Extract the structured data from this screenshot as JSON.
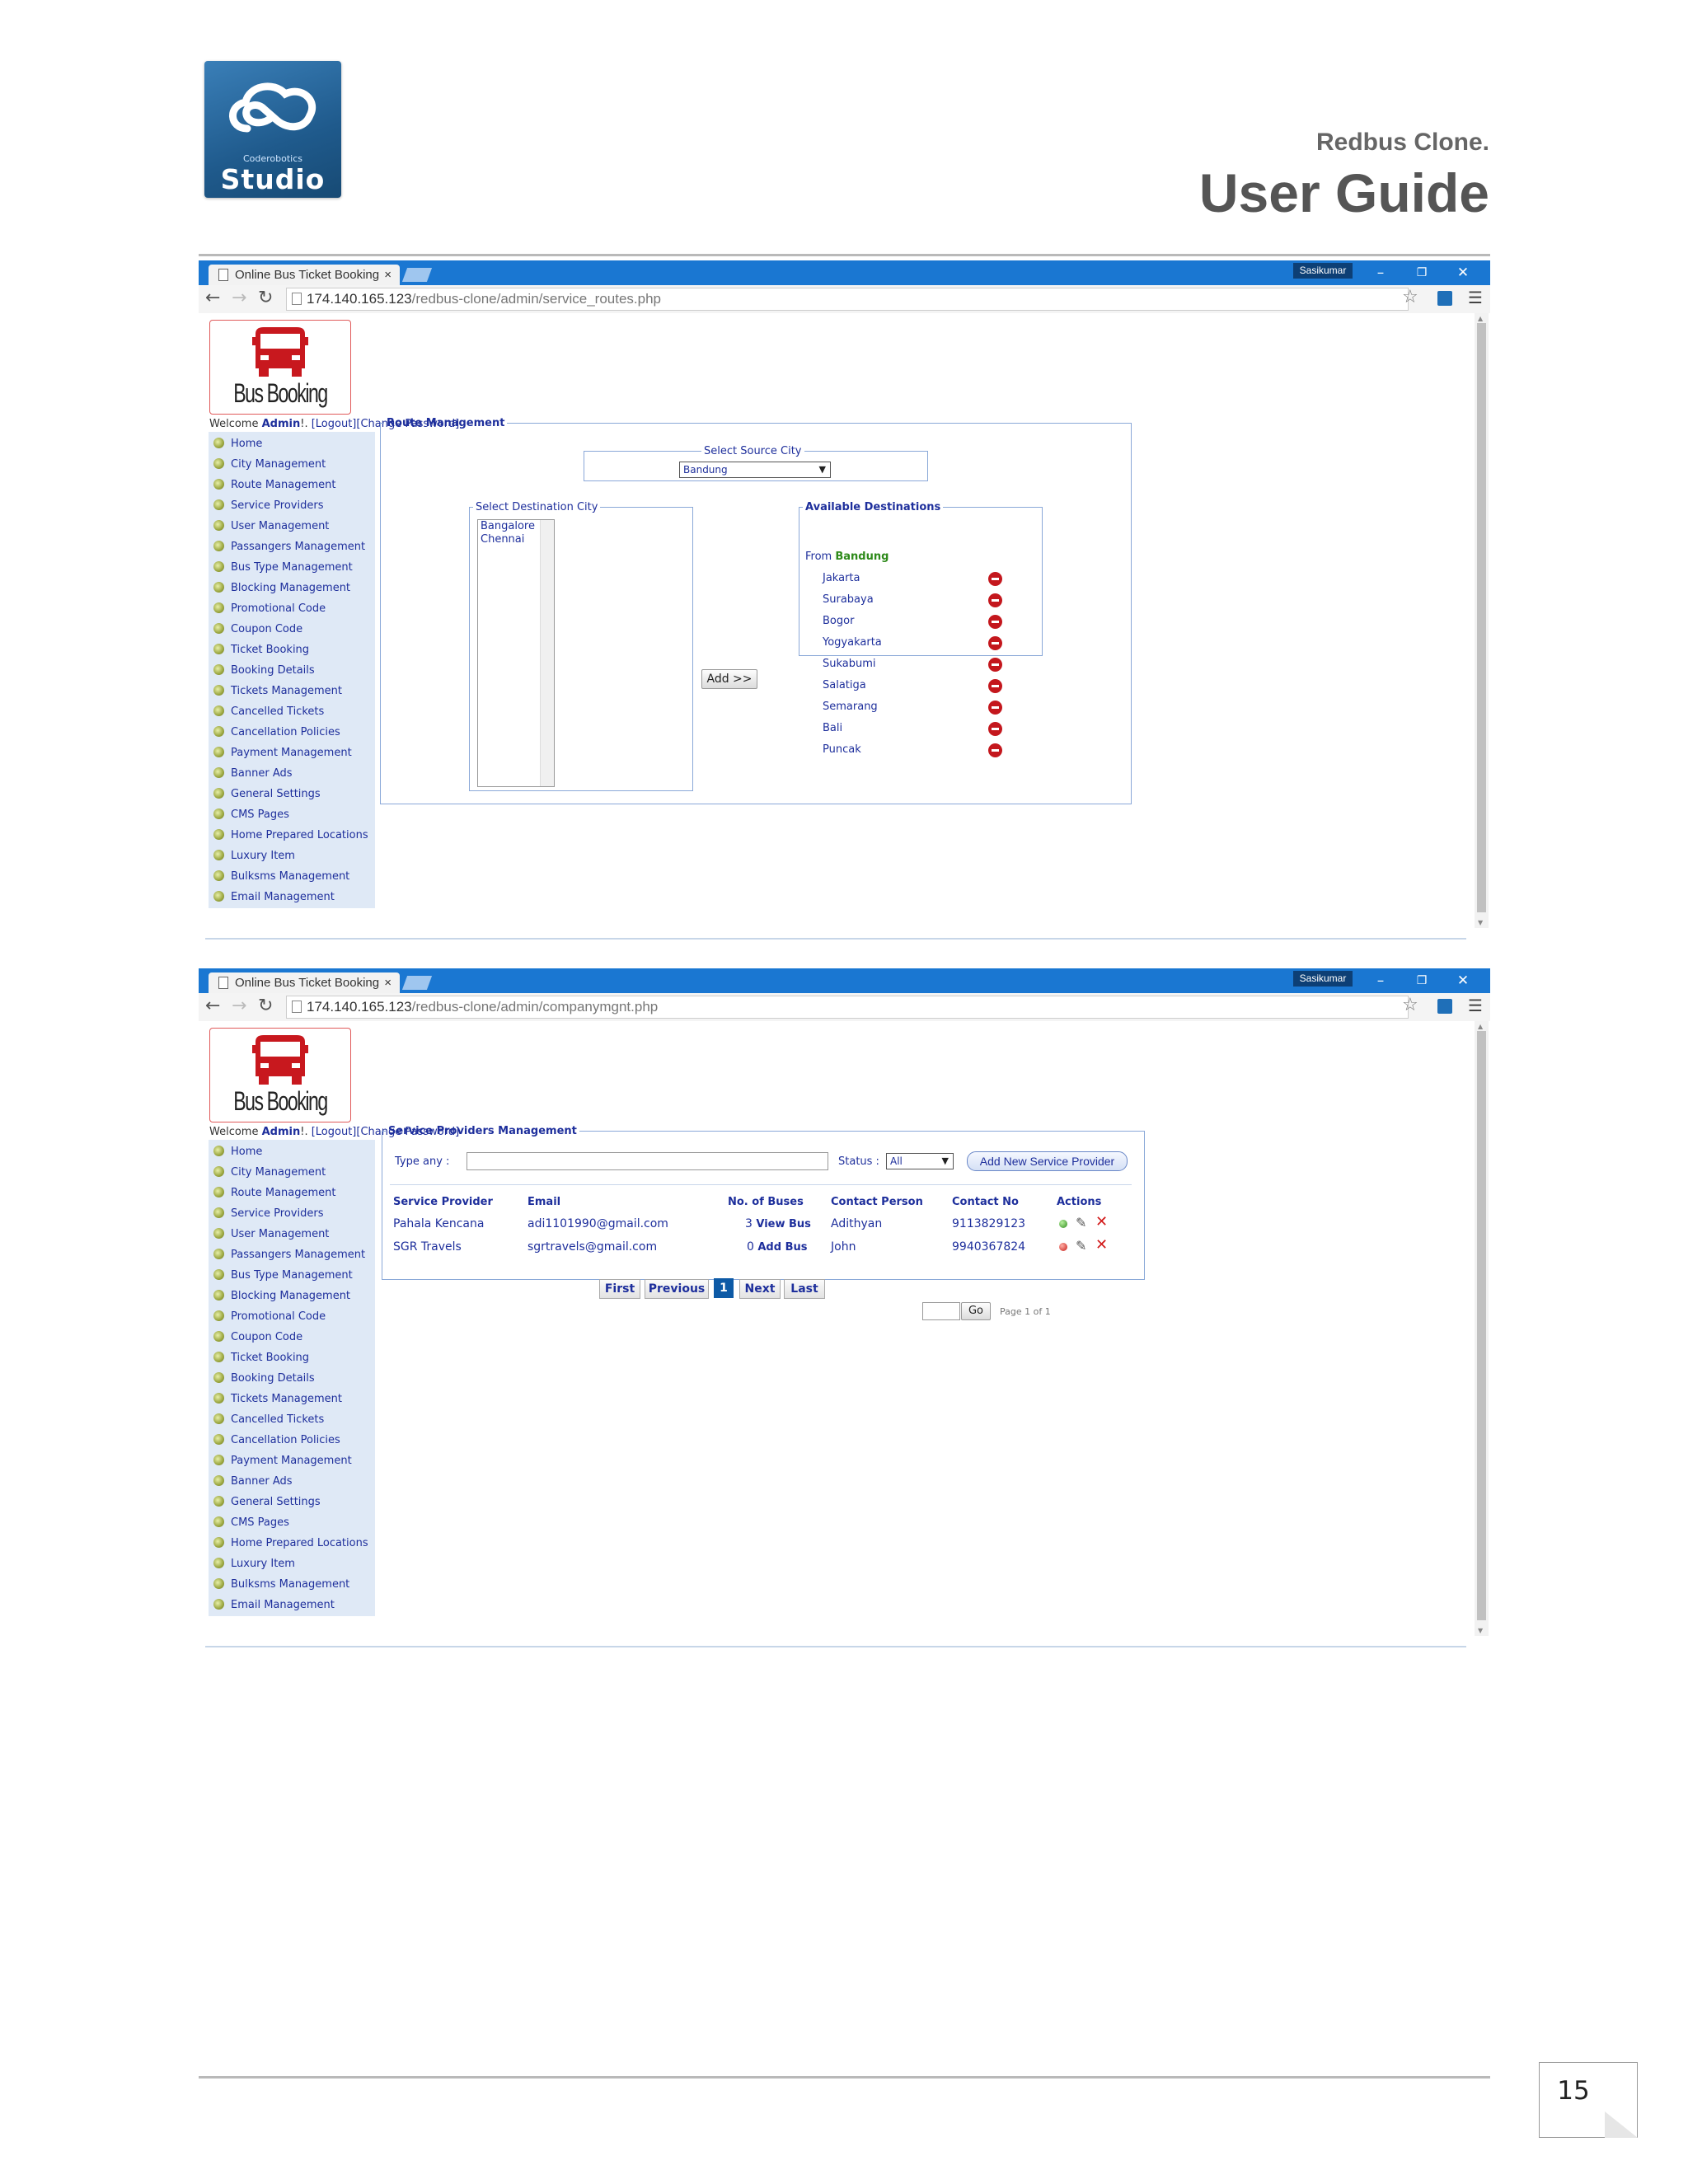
{
  "doc": {
    "brand_small": "Coderobotics",
    "brand_studio": "Studio",
    "subtitle": "Redbus Clone.",
    "title": "User Guide",
    "page_number": "15"
  },
  "colors": {
    "browser_blue": "#1a77d2",
    "link_blue": "#1e2f9c",
    "sidebar_bg": "#dfe9f6",
    "remove_red": "#c4171d",
    "active_page": "#0d5aa6"
  },
  "browser": {
    "tab_title": "Online Bus Ticket Booking",
    "tab_close": "×",
    "user": "Sasikumar",
    "min_glyph": "–",
    "restore_glyph": "❐",
    "close_glyph": "✕",
    "back_icon": "back-arrow-icon",
    "url_host": "174.140.165.123",
    "url1_path": "/redbus-clone/admin/service_routes.php",
    "url2_path": "/redbus-clone/admin/companymgnt.php"
  },
  "app": {
    "logo_text": "Bus Booking",
    "welcome_prefix": "Welcome ",
    "admin_name": "Admin",
    "welcome_mid": "!. ",
    "logout": "[Logout]",
    "change_password": "[Change Password]",
    "menu": [
      "Home",
      "City Management",
      "Route Management",
      "Service Providers",
      "User Management",
      "Passangers Management",
      "Bus Type Management",
      "Blocking Management",
      "Promotional Code",
      "Coupon Code",
      "Ticket Booking",
      "Booking Details",
      "Tickets Management",
      "Cancelled Tickets",
      "Cancellation Policies",
      "Payment Management",
      "Banner Ads",
      "General Settings",
      "CMS Pages",
      "Home Prepared Locations",
      "Luxury Item",
      "Bulksms Management",
      "Email Management"
    ]
  },
  "route": {
    "legend": "Route Management",
    "source_legend": "Select Source City",
    "source_value": "Bandung",
    "dest_legend": "Select Destination City",
    "dest_options": [
      "Bangalore",
      "Chennai"
    ],
    "add_button": "Add >>",
    "available_legend": "Available Destinations",
    "from_label": "From ",
    "from_city": "Bandung",
    "destinations": [
      "Jakarta",
      "Surabaya",
      "Bogor",
      "Yogyakarta",
      "Sukabumi",
      "Salatiga",
      "Semarang",
      "Bali",
      "Puncak"
    ]
  },
  "providers": {
    "legend": "Service Providers Management",
    "type_label": "Type any :",
    "status_label": "Status :",
    "status_value": "All",
    "add_button": "Add New Service Provider",
    "columns": [
      "Service Provider",
      "Email",
      "No. of Buses",
      "Contact Person",
      "Contact No",
      "Actions"
    ],
    "rows": [
      {
        "name": "Pahala Kencana",
        "email": "adi1101990@gmail.com",
        "count": "3",
        "bus_link": "View Bus",
        "contact": "Adithyan",
        "phone": "9113829123",
        "status": "active"
      },
      {
        "name": "SGR Travels",
        "email": "sgrtravels@gmail.com",
        "count": "0",
        "bus_link": "Add Bus",
        "contact": "John",
        "phone": "9940367824",
        "status": "inactive"
      }
    ],
    "pager": {
      "first": "First",
      "previous": "Previous",
      "current": "1",
      "next": "Next",
      "last": "Last",
      "go": "Go",
      "page_info": "Page 1 of 1"
    }
  }
}
